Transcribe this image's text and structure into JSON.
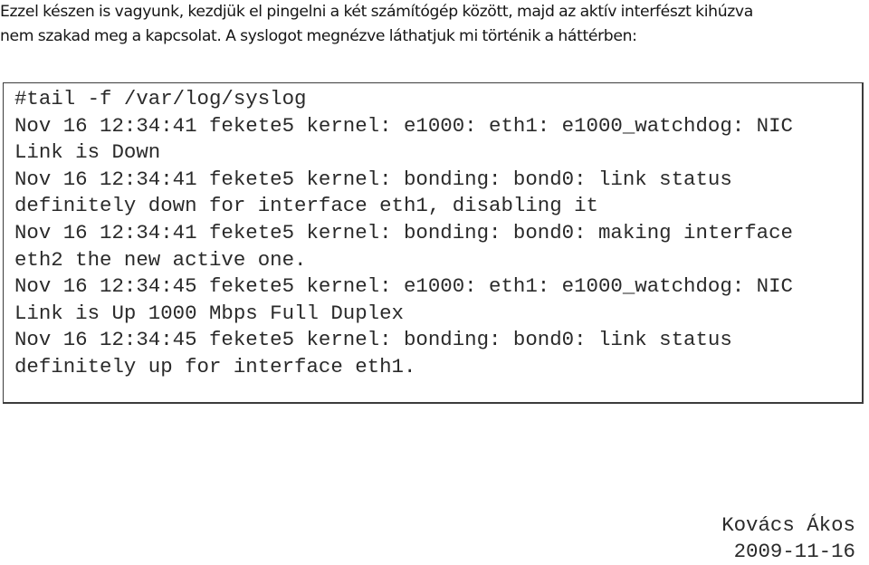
{
  "intro": {
    "lines": [
      "Ezzel készen is vagyunk, kezdjük el pingelni a két számítógép között, majd az aktív interfészt kihúzva",
      "nem szakad meg a kapcsolat. A syslogot megnézve láthatjuk mi történik a háttérben:"
    ]
  },
  "log": {
    "lines": [
      "#tail -f /var/log/syslog",
      "Nov 16 12:34:41 fekete5 kernel: e1000: eth1: e1000_watchdog: NIC",
      "Link is Down",
      "Nov 16 12:34:41 fekete5 kernel: bonding: bond0: link status",
      "definitely down for interface eth1, disabling it",
      "Nov 16 12:34:41 fekete5 kernel: bonding: bond0: making interface",
      "eth2 the new active one.",
      "Nov 16 12:34:45 fekete5 kernel: e1000: eth1: e1000_watchdog: NIC",
      "Link is Up 1000 Mbps Full Duplex",
      "Nov 16 12:34:45 fekete5 kernel: bonding: bond0: link status",
      "definitely up for interface eth1."
    ]
  },
  "signature": {
    "author": "Kovács Ákos",
    "date": "2009-11-16"
  }
}
